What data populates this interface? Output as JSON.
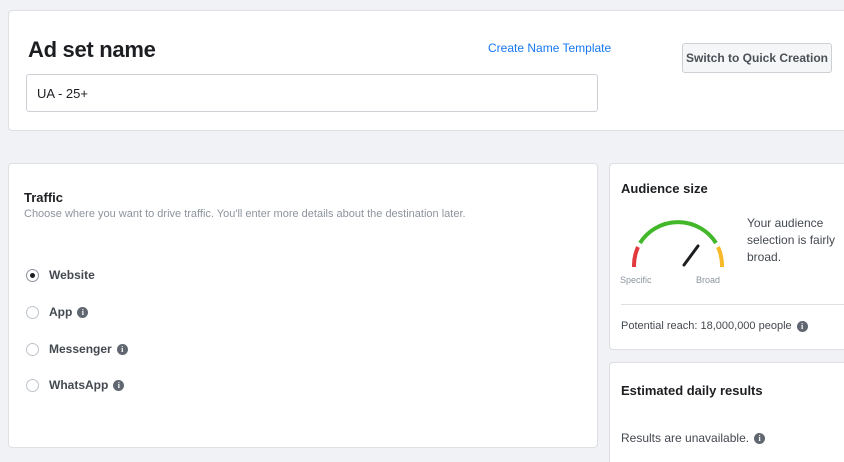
{
  "adset": {
    "title": "Ad set name",
    "name_template_link": "Create Name Template",
    "quick_creation_label": "Switch to Quick Creation",
    "name_value": "UA - 25+"
  },
  "traffic": {
    "title": "Traffic",
    "description": "Choose where you want to drive traffic. You'll enter more details about the destination later.",
    "options": [
      {
        "label": "Website",
        "selected": true,
        "info": false
      },
      {
        "label": "App",
        "selected": false,
        "info": true
      },
      {
        "label": "Messenger",
        "selected": false,
        "info": true
      },
      {
        "label": "WhatsApp",
        "selected": false,
        "info": true
      }
    ],
    "selected_option": "Website"
  },
  "audience": {
    "title": "Audience size",
    "gauge_left_label": "Specific",
    "gauge_right_label": "Broad",
    "description": "Your audience selection is fairly broad.",
    "potential_reach": "Potential reach: 18,000,000 people"
  },
  "estimated": {
    "title": "Estimated daily results",
    "results_text": "Results are unavailable."
  },
  "icons": {
    "info": "info-icon",
    "radio_checked": "radio-checked-icon",
    "radio_unchecked": "radio-unchecked-icon"
  },
  "colors": {
    "link": "#1877f2",
    "gauge_red": "#e0393e",
    "gauge_green": "#42b72a",
    "gauge_orange": "#f7b928",
    "background": "#f0f2f5"
  }
}
